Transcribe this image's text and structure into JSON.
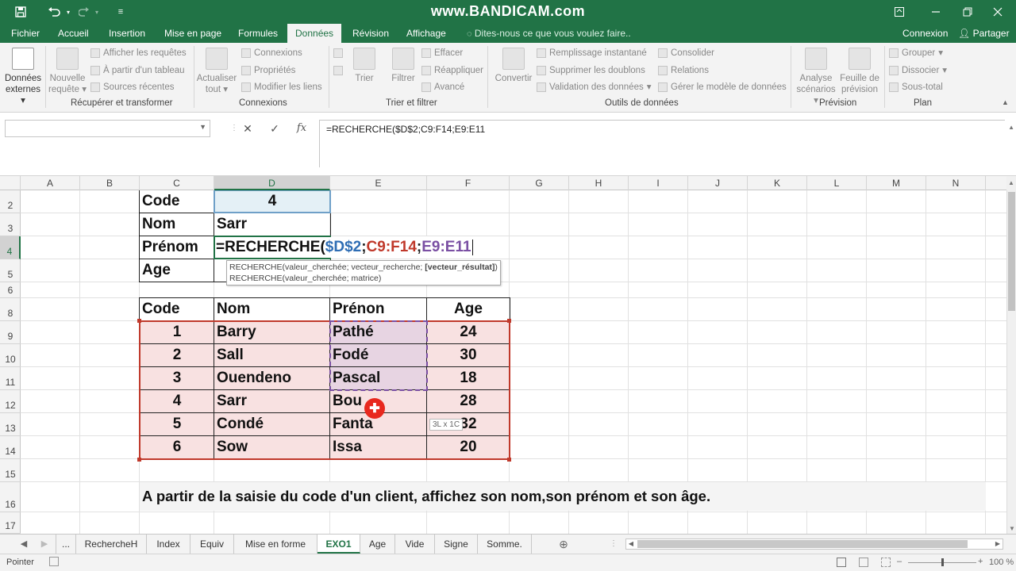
{
  "titlebar": {
    "watermark": "www.BANDICAM.com"
  },
  "menu": {
    "tabs": [
      "Fichier",
      "Accueil",
      "Insertion",
      "Mise en page",
      "Formules",
      "Données",
      "Révision",
      "Affichage"
    ],
    "tell_me": "Dites-nous ce que vous voulez faire..",
    "connexion": "Connexion",
    "partager": "Partager"
  },
  "ribbon": {
    "donnees_externes": [
      "Données",
      "externes"
    ],
    "nouvelle_requete": [
      "Nouvelle",
      "requête"
    ],
    "afficher_requetes": "Afficher les requêtes",
    "partir_tableau": "À partir d'un tableau",
    "sources_recentes": "Sources récentes",
    "actualiser": [
      "Actualiser",
      "tout"
    ],
    "connexions": "Connexions",
    "proprietes": "Propriétés",
    "modifier_liens": "Modifier les liens",
    "trier": "Trier",
    "filtrer": "Filtrer",
    "effacer": "Effacer",
    "reappliquer": "Réappliquer",
    "avance": "Avancé",
    "convertir": "Convertir",
    "remplissage": "Remplissage instantané",
    "supprimer_doublons": "Supprimer les doublons",
    "validation": "Validation des données",
    "consolider": "Consolider",
    "relations": "Relations",
    "modele": "Gérer le modèle de données",
    "analyse": [
      "Analyse",
      "scénarios"
    ],
    "feuille_prevision": [
      "Feuille de",
      "prévision"
    ],
    "grouper": "Grouper",
    "dissocier": "Dissocier",
    "sous_total": "Sous-total",
    "groups": {
      "recuperer": "Récupérer et transformer",
      "connexions": "Connexions",
      "trier_filtrer": "Trier et filtrer",
      "outils": "Outils de données",
      "prevision": "Prévision",
      "plan": "Plan"
    }
  },
  "formula_bar": {
    "name_box": "",
    "formula": "=RECHERCHE($D$2;C9:F14;E9:E11"
  },
  "columns": [
    "A",
    "B",
    "C",
    "D",
    "E",
    "F",
    "G",
    "H",
    "I",
    "J",
    "K",
    "L",
    "M",
    "N"
  ],
  "rows": [
    "2",
    "3",
    "4",
    "5",
    "6",
    "8",
    "9",
    "10",
    "11",
    "12",
    "13",
    "14",
    "15",
    "16",
    "17"
  ],
  "lookup": {
    "code_label": "Code",
    "code_value": "4",
    "nom_label": "Nom",
    "nom_value": "Sarr",
    "prenom_label": "Prénom",
    "age_label": "Age",
    "edit_formula": {
      "prefix": "=RECHERCHE(",
      "ref1": "$D$2",
      "sep1": ";",
      "ref2": "C9:F14",
      "sep2": ";",
      "ref3": "E9:E11"
    }
  },
  "tooltip": {
    "line1_pre": "RECHERCHE(valeur_cherchée; vecteur_recherche; ",
    "line1_bold": "[vecteur_résultat]",
    "line1_post": ")",
    "line2": "RECHERCHE(valeur_cherchée; matrice)"
  },
  "table": {
    "headers": [
      "Code",
      "Nom",
      "Prénon",
      "Age"
    ],
    "rows": [
      [
        "1",
        "Barry",
        "Pathé",
        "24"
      ],
      [
        "2",
        "Sall",
        "Fodé",
        "30"
      ],
      [
        "3",
        "Ouendeno",
        "Pascal",
        "18"
      ],
      [
        "4",
        "Sarr",
        "Bou",
        "28"
      ],
      [
        "5",
        "Condé",
        "Fanta",
        "32"
      ],
      [
        "6",
        "Sow",
        "Issa",
        "20"
      ]
    ]
  },
  "size_hint": "3L x 1C",
  "instruction": "A partir de la saisie du code d'un client, affichez son nom,son prénom et son âge.",
  "sheets": [
    "...",
    "RechercheH",
    "Index",
    "Equiv",
    "Mise en forme",
    "EXO1",
    "Age",
    "Vide",
    "Signe",
    "Somme."
  ],
  "active_sheet": "EXO1",
  "status": {
    "mode": "Pointer",
    "zoom": "100 %"
  },
  "colors": {
    "excel_green": "#217346",
    "ref1": "#2e6db4",
    "ref2": "#c0392b",
    "ref3": "#7a4fa3",
    "table_fill": "#f8e1e1"
  }
}
